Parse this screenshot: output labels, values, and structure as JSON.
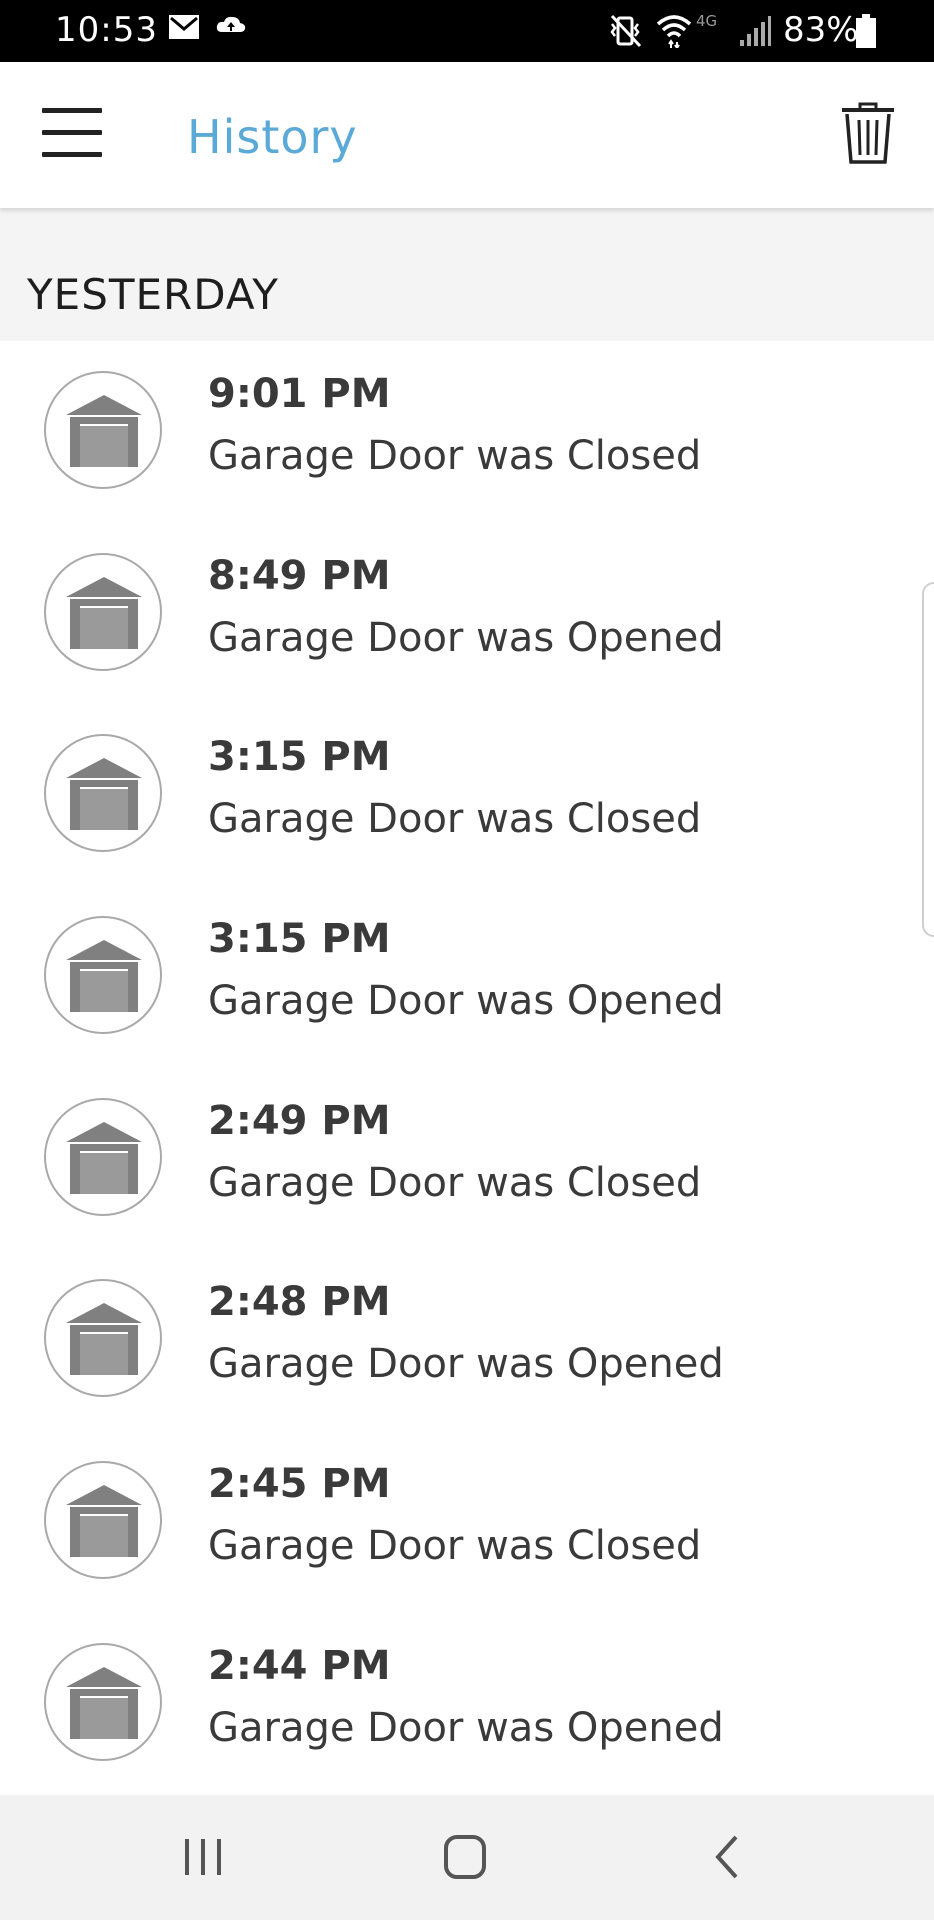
{
  "status_bar": {
    "time": "10:53",
    "icons": [
      "gmail-icon",
      "cloud-upload-icon",
      "vibrate-icon",
      "wifi-icon",
      "4g-lte-icon",
      "signal-icon",
      "battery-icon"
    ],
    "battery_percent": "83%"
  },
  "app_bar": {
    "title": "History",
    "title_color": "#5aa9d6",
    "menu_icon": "hamburger-icon",
    "action_icon": "trash-icon"
  },
  "section": {
    "label": "YESTERDAY"
  },
  "events": [
    {
      "time": "9:01 PM",
      "text": "Garage Door was Closed",
      "icon": "garage-icon"
    },
    {
      "time": "8:49 PM",
      "text": "Garage Door was Opened",
      "icon": "garage-icon"
    },
    {
      "time": "3:15 PM",
      "text": "Garage Door was Closed",
      "icon": "garage-icon"
    },
    {
      "time": "3:15 PM",
      "text": "Garage Door was Opened",
      "icon": "garage-icon"
    },
    {
      "time": "2:49 PM",
      "text": "Garage Door was Closed",
      "icon": "garage-icon"
    },
    {
      "time": "2:48 PM",
      "text": "Garage Door was Opened",
      "icon": "garage-icon"
    },
    {
      "time": "2:45 PM",
      "text": "Garage Door was Closed",
      "icon": "garage-icon"
    },
    {
      "time": "2:44 PM",
      "text": "Garage Door was Opened",
      "icon": "garage-icon"
    }
  ],
  "nav_bar": {
    "icons": [
      "recent-apps-icon",
      "home-icon",
      "back-icon"
    ]
  }
}
